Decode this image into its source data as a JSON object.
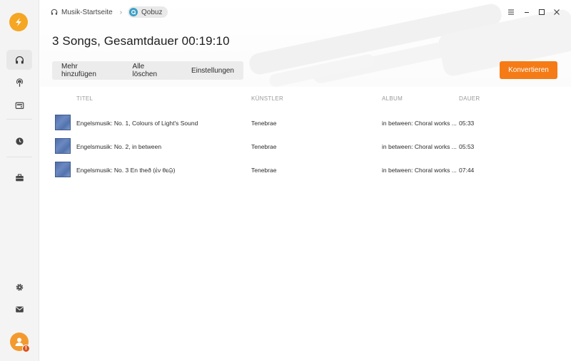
{
  "breadcrumb": {
    "home": "Musik-Startseite",
    "current": "Qobuz"
  },
  "page": {
    "title": "3 Songs, Gesamtdauer 00:19:10"
  },
  "toolbar": {
    "add_more": "Mehr hinzufügen",
    "clear_all": "Alle löschen",
    "settings": "Einstellungen",
    "convert": "Konvertieren"
  },
  "table": {
    "headers": {
      "title": "TITEL",
      "artist": "KÜNSTLER",
      "album": "ALBUM",
      "duration": "DAUER"
    },
    "rows": [
      {
        "title": "Engelsmusik: No. 1, Colours of Light's Sound",
        "artist": "Tenebrae",
        "album": "in between: Choral works ...",
        "duration": "05:33"
      },
      {
        "title": "Engelsmusik: No. 2, in between",
        "artist": "Tenebrae",
        "album": "in between: Choral works ...",
        "duration": "05:53"
      },
      {
        "title": "Engelsmusik: No. 3 En theð (ἐν θεῷ)",
        "artist": "Tenebrae",
        "album": "in between: Choral works ...",
        "duration": "07:44"
      }
    ]
  },
  "colors": {
    "accent": "#f47b16",
    "logo": "#f5a623",
    "qobuz": "#3a9fc6"
  },
  "icons": {
    "sidebar": [
      "headphones-icon",
      "podcast-icon",
      "radio-icon",
      "history-icon",
      "toolbox-icon",
      "settings-icon",
      "mail-icon"
    ],
    "window": [
      "menu-icon",
      "minimize-icon",
      "maximize-icon",
      "close-icon"
    ]
  }
}
